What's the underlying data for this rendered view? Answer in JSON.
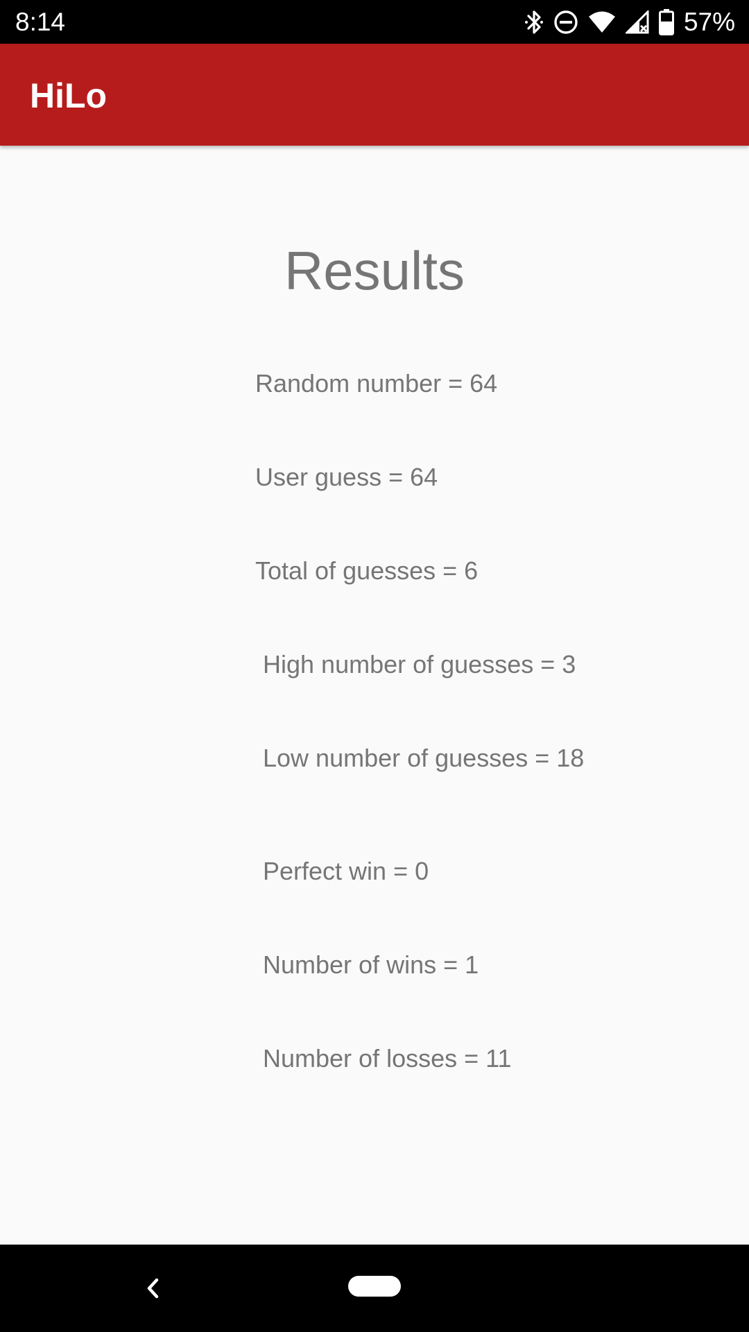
{
  "status_bar": {
    "time": "8:14",
    "battery_percent": "57%",
    "icons": [
      "bluetooth-icon",
      "do-not-disturb-icon",
      "wifi-icon",
      "cell-signal-icon",
      "battery-icon"
    ]
  },
  "app_bar": {
    "title": "HiLo",
    "color": "#b71c1c"
  },
  "results": {
    "title": "Results",
    "random_number": "Random number = 64",
    "user_guess": "User guess = 64",
    "total_guesses": "Total of guesses = 6",
    "high_guesses": "High number of guesses = 3",
    "low_guesses": "Low number of guesses = 18",
    "perfect_win": "Perfect win = 0",
    "wins": "Number of wins = 1",
    "losses": "Number of losses = 11"
  },
  "nav_bar": {
    "icons": [
      "back-icon",
      "home-pill-icon"
    ]
  }
}
